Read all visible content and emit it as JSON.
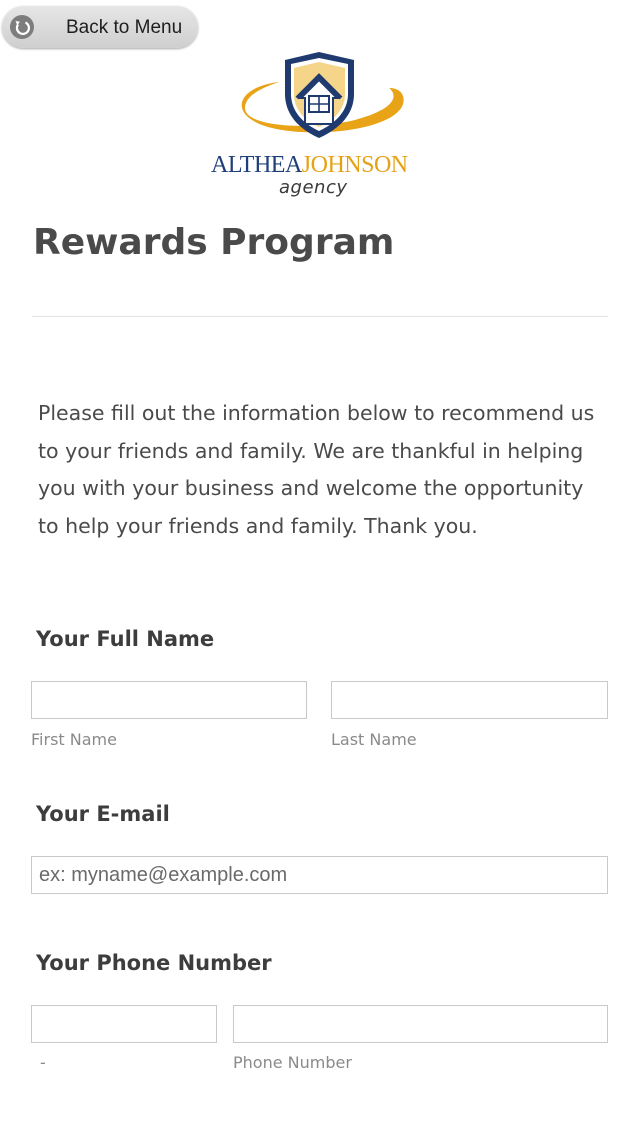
{
  "back_button": {
    "label": "Back to Menu",
    "icon": "back-arrow-icon"
  },
  "logo": {
    "word_part1": "ALTHEA",
    "word_part2": "JOHNSON",
    "sub": "agency"
  },
  "page": {
    "title": "Rewards Program",
    "intro": "Please fill out the information below to recommend us to your friends and family. We are thankful in helping you with your business and welcome the opportunity to help your friends and family. Thank you."
  },
  "form": {
    "full_name": {
      "label": "Your Full Name",
      "first": {
        "value": "",
        "sublabel": "First Name"
      },
      "last": {
        "value": "",
        "sublabel": "Last Name"
      }
    },
    "email": {
      "label": "Your E-mail",
      "value": "",
      "placeholder": "ex: myname@example.com"
    },
    "phone": {
      "label": "Your Phone Number",
      "area": {
        "value": "",
        "sublabel": "-"
      },
      "number": {
        "value": "",
        "sublabel": "Phone Number"
      }
    }
  },
  "colors": {
    "brand_blue": "#1f3f78",
    "brand_gold": "#e6a216",
    "text": "#3d3d3d",
    "input_border": "#c9c9c9"
  }
}
